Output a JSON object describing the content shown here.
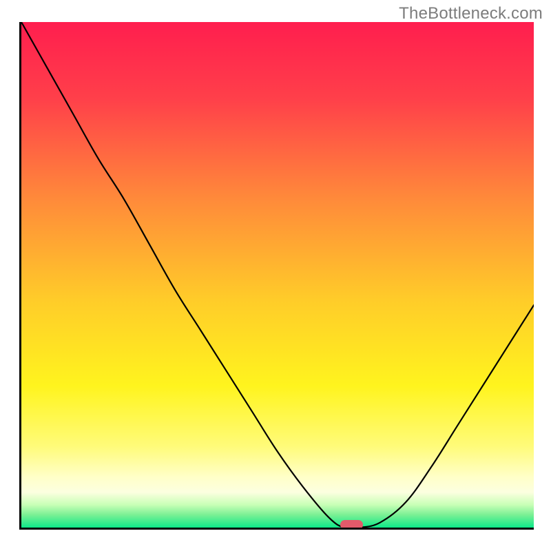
{
  "watermark": "TheBottleneck.com",
  "chart_data": {
    "type": "line",
    "title": "",
    "xlabel": "",
    "ylabel": "",
    "x": [
      0.0,
      0.05,
      0.1,
      0.15,
      0.2,
      0.25,
      0.3,
      0.35,
      0.4,
      0.45,
      0.5,
      0.55,
      0.6,
      0.63,
      0.66,
      0.7,
      0.75,
      0.8,
      0.85,
      0.9,
      0.95,
      1.0
    ],
    "y": [
      1.0,
      0.91,
      0.82,
      0.73,
      0.65,
      0.56,
      0.47,
      0.39,
      0.31,
      0.23,
      0.15,
      0.08,
      0.02,
      0.0,
      0.0,
      0.01,
      0.05,
      0.12,
      0.2,
      0.28,
      0.36,
      0.44
    ],
    "xlim": [
      0,
      1
    ],
    "ylim": [
      0,
      1
    ],
    "marker": {
      "x": 0.645,
      "y": 0.0
    },
    "gradient_stops": [
      {
        "pos": 0.0,
        "color": "#ff1e4e"
      },
      {
        "pos": 0.15,
        "color": "#ff3f4a"
      },
      {
        "pos": 0.35,
        "color": "#ff8a3a"
      },
      {
        "pos": 0.55,
        "color": "#ffcc29"
      },
      {
        "pos": 0.72,
        "color": "#fff41e"
      },
      {
        "pos": 0.84,
        "color": "#fffb7a"
      },
      {
        "pos": 0.9,
        "color": "#ffffc8"
      },
      {
        "pos": 0.93,
        "color": "#fcffe0"
      },
      {
        "pos": 0.955,
        "color": "#c8ffb6"
      },
      {
        "pos": 0.975,
        "color": "#7af094"
      },
      {
        "pos": 1.0,
        "color": "#0de889"
      }
    ]
  }
}
